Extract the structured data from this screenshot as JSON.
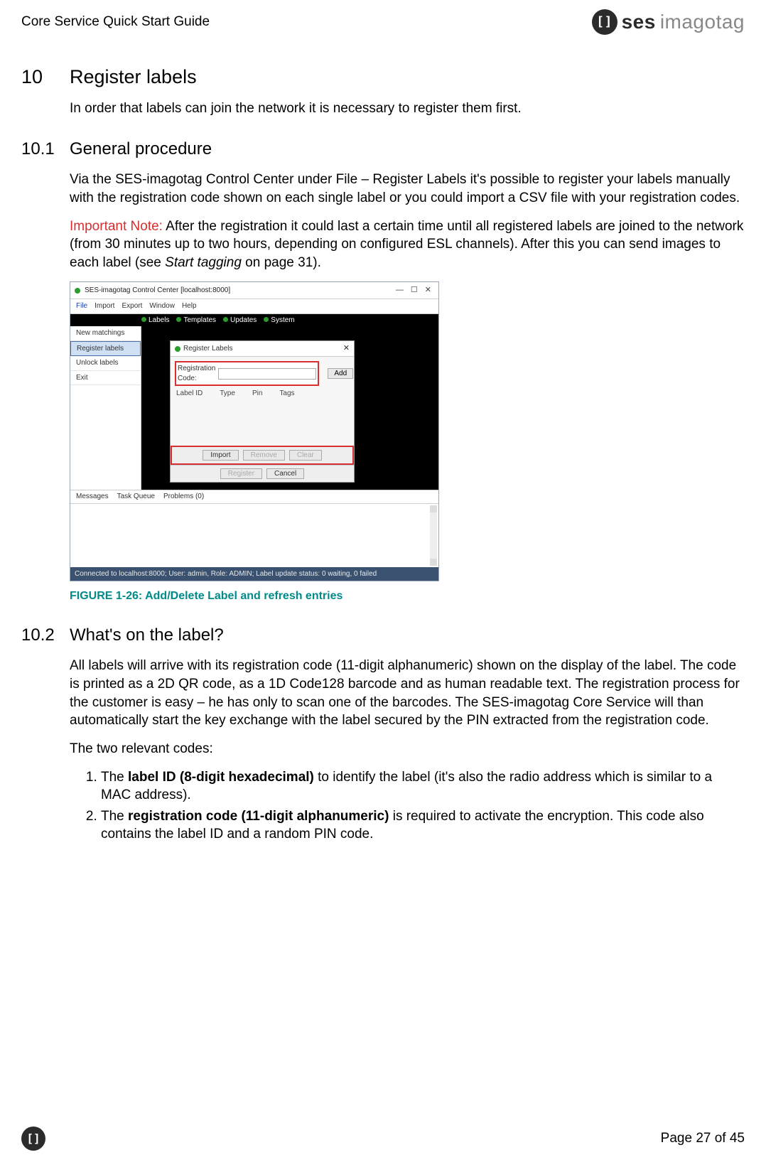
{
  "header": {
    "doc_title": "Core Service Quick Start Guide",
    "brand_ses": "ses",
    "brand_imagotag": "imagotag",
    "brand_glyph": "[]"
  },
  "section10": {
    "num": "10",
    "title": "Register labels",
    "intro": "In order that labels can join the network it is necessary to register them first."
  },
  "section10_1": {
    "num": "10.1",
    "title": "General procedure",
    "p1": "Via the SES-imagotag Control Center under File – Register Labels it's possible to register your labels manually with the registration code shown on each single label or you could import a CSV file with your registration codes.",
    "important_label": "Important Note:",
    "important_text": " After the registration it could last a certain time until all registered labels are joined to the network (from 30 minutes up to two hours, depending on configured ESL channels). After this you can send images to each label (see ",
    "important_italic": "Start tagging",
    "important_tail": " on page 31).",
    "figure_caption": "FIGURE 1-26: Add/Delete Label and refresh entries"
  },
  "screenshot": {
    "title": "SES-imagotag Control Center [localhost:8000]",
    "menu_file": "File",
    "menu_import": "Import",
    "menu_export": "Export",
    "menu_window": "Window",
    "menu_help": "Help",
    "sidebar_new": "New matchings",
    "sidebar_register": "Register labels",
    "sidebar_unlock": "Unlock labels",
    "sidebar_exit": "Exit",
    "tab_labels": "Labels",
    "tab_templates": "Templates",
    "tab_updates": "Updates",
    "tab_system": "System",
    "dialog_title": "Register Labels",
    "reg_label": "Registration Code:",
    "add_btn": "Add",
    "col_labelid": "Label ID",
    "col_type": "Type",
    "col_pin": "Pin",
    "col_tags": "Tags",
    "btn_import": "Import",
    "btn_remove": "Remove",
    "btn_clear": "Clear",
    "btn_register": "Register",
    "btn_cancel": "Cancel",
    "bottom_messages": "Messages",
    "bottom_queue": "Task Queue",
    "bottom_problems": "Problems (0)",
    "status": "Connected to localhost:8000; User: admin, Role: ADMIN; Label update status: 0 waiting, 0 failed"
  },
  "section10_2": {
    "num": "10.2",
    "title": "What's on the label?",
    "p1": "All labels will arrive with its registration code (11-digit alphanumeric) shown on the display of the label. The code is printed as a 2D QR code, as a 1D Code128 barcode and as human readable text. The registration process for the customer is easy – he has only to scan one of the barcodes. The SES-imagotag Core Service will than automatically start the key exchange with the label secured by the PIN extracted from the registration code.",
    "p2": "The two relevant codes:",
    "li1_pre": "The ",
    "li1_bold": "label ID (8-digit hexadecimal)",
    "li1_post": " to identify the label (it's also the radio address which is similar to a MAC address).",
    "li2_pre": "The ",
    "li2_bold": "registration code (11-digit alphanumeric)",
    "li2_post": " is required to activate the encryption. This code also contains the label ID and a random PIN code."
  },
  "footer": {
    "glyph": "[]",
    "page": "Page 27 of 45"
  }
}
